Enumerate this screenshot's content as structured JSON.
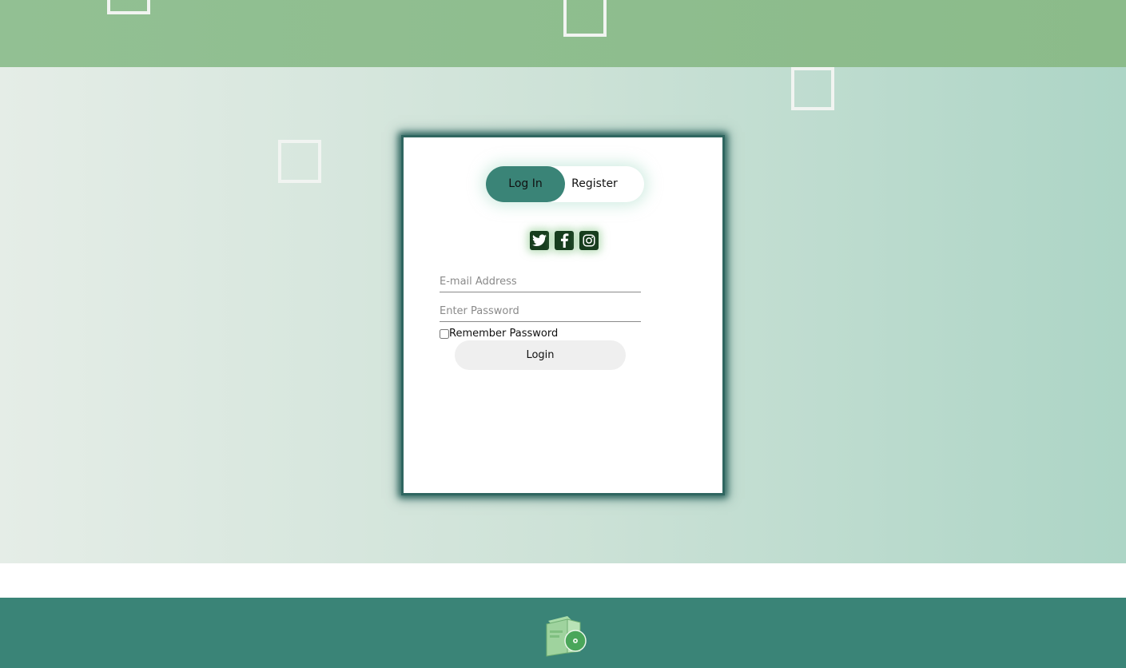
{
  "auth_toggle": {
    "login_label": "Log In",
    "register_label": "Register"
  },
  "social_icons": [
    "twitter-icon",
    "facebook-icon",
    "instagram-icon"
  ],
  "form": {
    "email_placeholder": "E-mail Address",
    "password_placeholder": "Enter Password",
    "remember_label": "Remember Password",
    "submit_label": "Login"
  },
  "footer": {
    "logo_icon": "software-box-icon"
  },
  "colors": {
    "primary": "#3a8477",
    "header_green": "#8fbd8d",
    "social_bg": "#173d1e",
    "card_border": "#2f6660"
  }
}
